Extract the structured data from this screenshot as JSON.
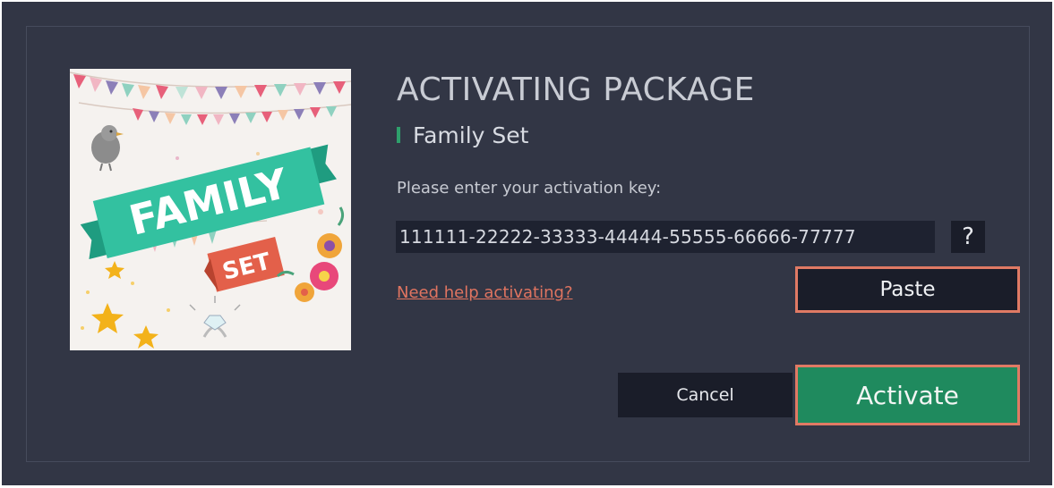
{
  "dialog": {
    "title": "ACTIVATING PACKAGE",
    "package_name": "Family Set",
    "prompt": "Please enter your activation key:",
    "activation_key": "111111-22222-33333-44444-55555-66666-77777",
    "help_icon": "?",
    "help_link": "Need help activating?",
    "buttons": {
      "paste": "Paste",
      "cancel": "Cancel",
      "activate": "Activate"
    }
  },
  "package_image": {
    "badge_main": "FAMILY",
    "badge_sub": "SET"
  },
  "colors": {
    "background": "#323645",
    "accent_green": "#1f8a5e",
    "highlight_border": "#e07a64",
    "link": "#e07460",
    "dark_button": "#1a1d29"
  }
}
